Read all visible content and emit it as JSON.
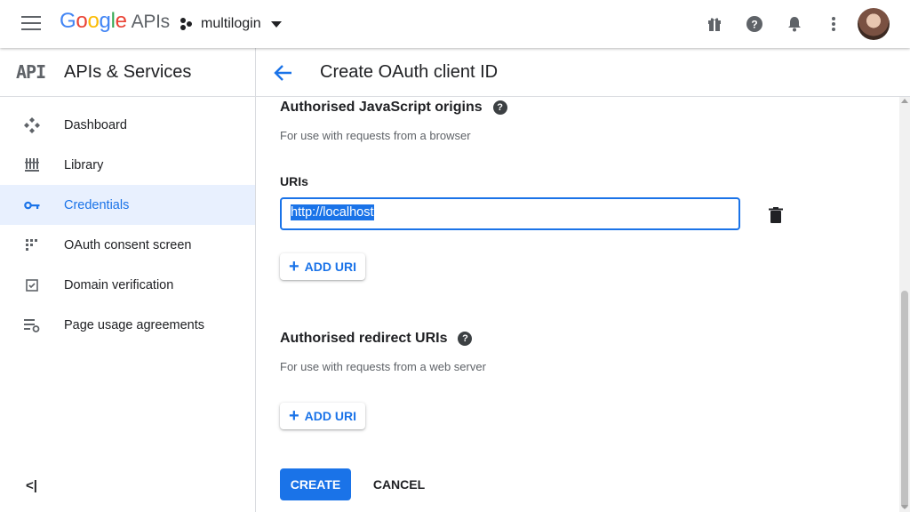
{
  "topbar": {
    "logo_letters": [
      "G",
      "o",
      "o",
      "g",
      "l",
      "e"
    ],
    "logo_suffix": "APIs",
    "project_name": "multilogin",
    "icons": [
      "menu-icon",
      "gift-icon",
      "help-icon",
      "notifications-icon",
      "more-vert-icon",
      "avatar"
    ]
  },
  "sidebar": {
    "logo_text": "API",
    "title": "APIs & Services",
    "items": [
      {
        "label": "Dashboard",
        "icon": "dashboard-icon",
        "active": false
      },
      {
        "label": "Library",
        "icon": "library-icon",
        "active": false
      },
      {
        "label": "Credentials",
        "icon": "key-icon",
        "active": true
      },
      {
        "label": "OAuth consent screen",
        "icon": "consent-icon",
        "active": false
      },
      {
        "label": "Domain verification",
        "icon": "checkbox-icon",
        "active": false
      },
      {
        "label": "Page usage agreements",
        "icon": "settings-list-icon",
        "active": false
      }
    ],
    "collapse_label": "<|"
  },
  "header": {
    "title": "Create OAuth client ID"
  },
  "js_origins": {
    "title": "Authorised JavaScript origins",
    "subtitle": "For use with requests from a browser",
    "uris_label": "URIs",
    "uri_value": "http://localhost",
    "add_uri_label": "ADD URI"
  },
  "redirect": {
    "title": "Authorised redirect URIs",
    "subtitle": "For use with requests from a web server",
    "add_uri_label": "ADD URI"
  },
  "actions": {
    "create_label": "CREATE",
    "cancel_label": "CANCEL"
  },
  "colors": {
    "accent": "#1a73e8",
    "active_bg": "#e8f0fe"
  }
}
